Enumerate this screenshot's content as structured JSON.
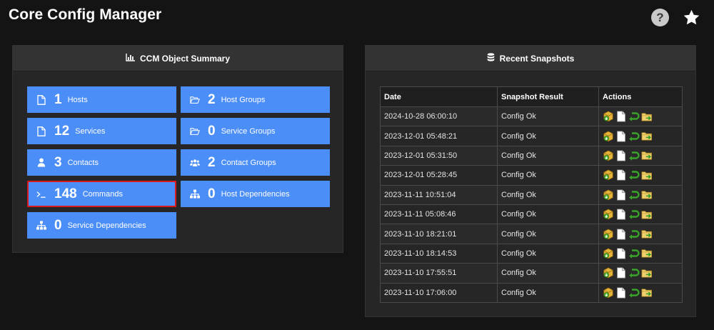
{
  "app": {
    "title": "Core Config Manager"
  },
  "top_icons": {
    "help": "help-icon",
    "favorite": "star-icon"
  },
  "summary": {
    "header": "CCM Object Summary",
    "header_icon": "bar-chart-icon",
    "tiles": [
      {
        "count": "1",
        "label": "Hosts",
        "icon": "file-icon"
      },
      {
        "count": "2",
        "label": "Host Groups",
        "icon": "folder-open-icon"
      },
      {
        "count": "12",
        "label": "Services",
        "icon": "file-icon"
      },
      {
        "count": "0",
        "label": "Service Groups",
        "icon": "folder-open-icon"
      },
      {
        "count": "3",
        "label": "Contacts",
        "icon": "user-icon"
      },
      {
        "count": "2",
        "label": "Contact Groups",
        "icon": "users-icon"
      },
      {
        "count": "148",
        "label": "Commands",
        "icon": "terminal-icon",
        "selected": true
      },
      {
        "count": "0",
        "label": "Host Dependencies",
        "icon": "sitemap-icon"
      },
      {
        "count": "0",
        "label": "Service Dependencies",
        "icon": "sitemap-icon"
      }
    ],
    "tile_color": "#4c8ef7",
    "selected_outline_color": "#d91a1a"
  },
  "snapshots": {
    "header": "Recent Snapshots",
    "header_icon": "database-icon",
    "columns": [
      "Date",
      "Snapshot Result",
      "Actions"
    ],
    "rows": [
      {
        "date": "2024-10-28 06:00:10",
        "result": "Config Ok"
      },
      {
        "date": "2023-12-01 05:48:21",
        "result": "Config Ok"
      },
      {
        "date": "2023-12-01 05:31:50",
        "result": "Config Ok"
      },
      {
        "date": "2023-12-01 05:28:45",
        "result": "Config Ok"
      },
      {
        "date": "2023-11-11 10:51:04",
        "result": "Config Ok"
      },
      {
        "date": "2023-11-11 05:08:46",
        "result": "Config Ok"
      },
      {
        "date": "2023-11-10 18:21:01",
        "result": "Config Ok"
      },
      {
        "date": "2023-11-10 18:14:53",
        "result": "Config Ok"
      },
      {
        "date": "2023-11-10 17:55:51",
        "result": "Config Ok"
      },
      {
        "date": "2023-11-10 17:06:00",
        "result": "Config Ok"
      }
    ],
    "actions": [
      "download-archive-icon",
      "view-file-icon",
      "restore-icon",
      "restore-folder-icon"
    ]
  }
}
